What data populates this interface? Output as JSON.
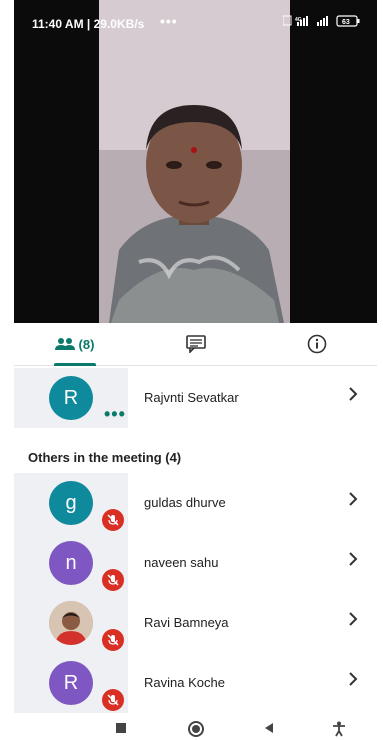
{
  "status_bar": {
    "time": "11:40 AM",
    "speed": "29.0KB/s",
    "indicators": "4G",
    "battery": "63",
    "icons": [
      "headset-icon",
      "more-dots-icon",
      "screenshot-icon",
      "signal-icon",
      "battery-icon"
    ]
  },
  "video": {
    "description": "participant-video-feed"
  },
  "tabs": {
    "people_count": "(8)",
    "icons": [
      "people-icon",
      "chat-icon",
      "info-icon"
    ]
  },
  "participants_top": [
    {
      "initial": "R",
      "name": "Rajvnti Sevatkar",
      "color": "#0e8a9c",
      "status": "more-options"
    }
  ],
  "section_title": "Others in the meeting (4)",
  "participants_others": [
    {
      "initial": "g",
      "name": "guldas dhurve",
      "color": "#0e8a9c",
      "muted": true
    },
    {
      "initial": "n",
      "name": "naveen sahu",
      "color": "#7e57c2",
      "muted": true
    },
    {
      "initial": "",
      "name": "Ravi Bamneya",
      "color": "#c9a48a",
      "muted": true,
      "photo": true
    },
    {
      "initial": "R",
      "name": "Ravina Koche",
      "color": "#7e57c2",
      "muted": true
    }
  ],
  "nav": [
    "recents-button",
    "home-button",
    "back-button",
    "accessibility-button"
  ]
}
